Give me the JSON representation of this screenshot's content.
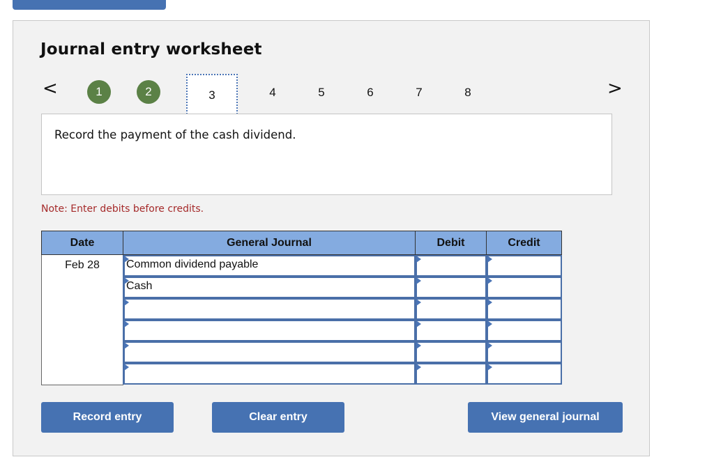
{
  "worksheet": {
    "title": "Journal entry worksheet",
    "nav": {
      "prev_icon": "chevron-left-icon",
      "next_icon": "chevron-right-icon",
      "prev_glyph": "<",
      "next_glyph": ">"
    },
    "steps": [
      {
        "label": "1",
        "state": "done"
      },
      {
        "label": "2",
        "state": "done"
      },
      {
        "label": "3",
        "state": "current"
      },
      {
        "label": "4",
        "state": "pending"
      },
      {
        "label": "5",
        "state": "pending"
      },
      {
        "label": "6",
        "state": "pending"
      },
      {
        "label": "7",
        "state": "pending"
      },
      {
        "label": "8",
        "state": "pending"
      }
    ],
    "prompt": "Record the payment of the cash dividend.",
    "note": "Note: Enter debits before credits.",
    "colors": {
      "step_done": "#5b8146",
      "header_bg": "#84abe0",
      "button_bg": "#4672b2",
      "note_text": "#a52a2a"
    }
  },
  "journal": {
    "headers": {
      "date": "Date",
      "general_journal": "General Journal",
      "debit": "Debit",
      "credit": "Credit"
    },
    "rows": [
      {
        "date": "Feb 28",
        "account": "Common dividend payable",
        "debit": "",
        "credit": ""
      },
      {
        "date": "",
        "account": "Cash",
        "debit": "",
        "credit": ""
      },
      {
        "date": "",
        "account": "",
        "debit": "",
        "credit": ""
      },
      {
        "date": "",
        "account": "",
        "debit": "",
        "credit": ""
      },
      {
        "date": "",
        "account": "",
        "debit": "",
        "credit": ""
      },
      {
        "date": "",
        "account": "",
        "debit": "",
        "credit": ""
      }
    ]
  },
  "buttons": {
    "record": "Record entry",
    "clear": "Clear entry",
    "view": "View general journal"
  }
}
